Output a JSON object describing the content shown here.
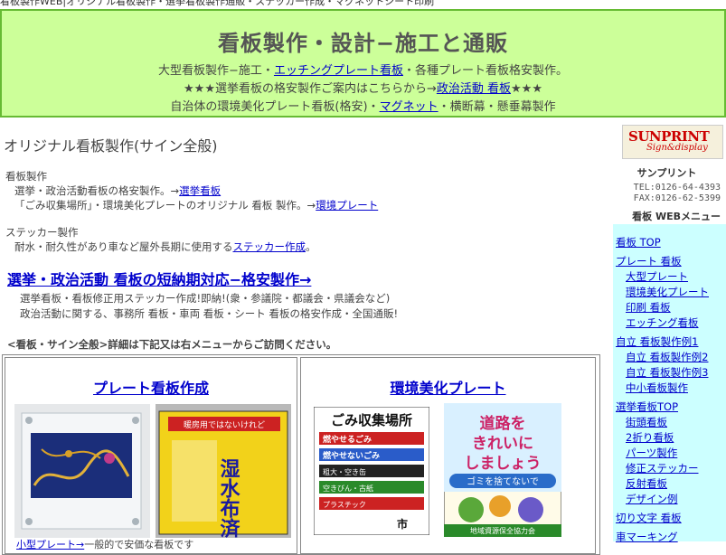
{
  "top_text": "看板製作WEB|オリジナル看板製作・選挙看板製作通販・ステッカー作成・マグネットシート印刷",
  "header": {
    "title": "看板製作・設計−施工と通販",
    "line1_pre": "大型看板製作−施工・",
    "line1_link": "エッチングプレート看板",
    "line1_post": "・各種プレート看板格安製作。",
    "line2_pre": "★★★選挙看板の格安製作ご案内はこちらから→",
    "line2_link": "政治活動 看板",
    "line2_post": "★★★",
    "line3_pre": "自治体の環境美化プレート看板(格安)・",
    "line3_link": "マグネット",
    "line3_post": "・横断幕・懸垂幕製作"
  },
  "main": {
    "page_title": "オリジナル看板製作(サイン全般)",
    "sec1_head": "看板製作",
    "sec1_l1_pre": "選挙・政治活動看板の格安製作。→",
    "sec1_l1_link": "選挙看板",
    "sec1_l2_pre": "「ごみ収集場所」・環境美化プレートのオリジナル 看板 製作。→",
    "sec1_l2_link": "環境プレート",
    "sec2_head": "ステッカー製作",
    "sec2_l1_pre": "耐水・耐久性があり車など屋外長期に使用する",
    "sec2_l1_link": "ステッカー作成",
    "sec2_l1_post": "。",
    "big_link": "選挙・政治活動 看板の短納期対応−格安製作→",
    "desc1": "選挙看板・看板修正用ステッカー作成!即納!(衆・参議院・都議会・県議会など)",
    "desc2": "政治活動に関する、事務所 看板・車両 看板・シート 看板の格安作成・全国通販!",
    "note": "<看板・サイン全般>詳細は下記又は右メニューからご訪問ください。",
    "cell1_title": "プレート看板作成",
    "cell2_title": "環境美化プレート",
    "cell1_bottom_link": "小型プレート→",
    "cell1_bottom_text": "一般的で安価な看板です",
    "sign_yellow_text": "湿水布済薬!",
    "sign_yellow_small": "暖房用ではないけれど",
    "garbage_title": "ごみ収集場所",
    "garbage_rows": [
      "燃やせるごみ",
      "燃やせないごみ",
      "粗大・空き缶",
      "空きびん・古紙",
      "プラスチック"
    ],
    "garbage_city": "市",
    "env_text1": "道路を",
    "env_text2": "きれいに",
    "env_text3": "しましょう",
    "env_text4": "ゴミを捨てないで",
    "env_footer": "地域資源保全協力会"
  },
  "sidebar": {
    "logo_main": "SUNPRINT",
    "logo_sub": "Sign&display",
    "company": "サンプリント",
    "tel": "TEL:0126-64-4393",
    "fax": "FAX:0126-62-5399",
    "menu_title": "看板 WEBメニュー",
    "items": [
      {
        "label": "看板 TOP",
        "indent": false
      },
      {
        "label": "プレート 看板",
        "indent": false
      },
      {
        "label": "大型プレート",
        "indent": true
      },
      {
        "label": "環境美化プレート",
        "indent": true
      },
      {
        "label": "印刷 看板",
        "indent": true
      },
      {
        "label": "エッチング看板",
        "indent": true
      },
      {
        "label": "自立 看板製作例1",
        "indent": false
      },
      {
        "label": "自立 看板製作例2",
        "indent": true
      },
      {
        "label": "自立 看板製作例3",
        "indent": true
      },
      {
        "label": "中小看板製作",
        "indent": true
      },
      {
        "label": "選挙看板TOP",
        "indent": false
      },
      {
        "label": "街頭看板",
        "indent": true
      },
      {
        "label": "2折り看板",
        "indent": true
      },
      {
        "label": "パーツ製作",
        "indent": true
      },
      {
        "label": "修正ステッカー",
        "indent": true
      },
      {
        "label": "反射看板",
        "indent": true
      },
      {
        "label": "デザイン例",
        "indent": true
      },
      {
        "label": "切り文字 看板",
        "indent": false
      },
      {
        "label": "車マーキング",
        "indent": false
      }
    ]
  }
}
